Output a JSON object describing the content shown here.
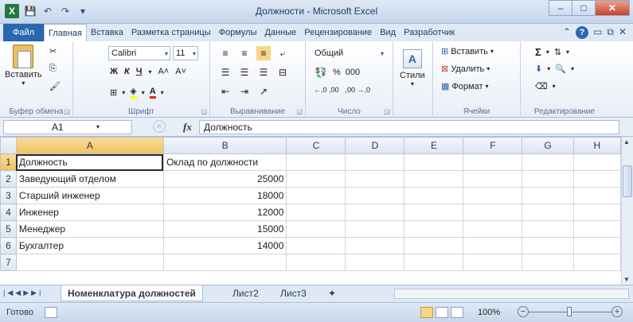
{
  "window": {
    "title": "Должности - Microsoft Excel",
    "minimize": "–",
    "maximize": "□",
    "close": "✕"
  },
  "qat": {
    "app_icon": "X",
    "save_icon": "save-icon",
    "undo_icon": "undo-icon",
    "redo_icon": "redo-icon"
  },
  "ribbon_tabs": [
    "Файл",
    "Главная",
    "Вставка",
    "Разметка страницы",
    "Формулы",
    "Данные",
    "Рецензирование",
    "Вид",
    "Разработчик"
  ],
  "ribbon": {
    "clipboard": {
      "label": "Буфер обмена",
      "paste": "Вставить"
    },
    "font": {
      "label": "Шрифт",
      "name": "Calibri",
      "size": "11",
      "bold": "Ж",
      "italic": "К",
      "underline": "Ч",
      "grow": "A˄",
      "shrink": "A˅"
    },
    "alignment": {
      "label": "Выравнивание"
    },
    "number": {
      "label": "Число",
      "format": "Общий",
      "percent": "%",
      "thousands": "000",
      "inc_decimal": "←,0 ,00",
      "dec_decimal": ",00 →,0"
    },
    "styles": {
      "label": "Стили"
    },
    "cells": {
      "label": "Ячейки",
      "insert": "Вставить",
      "delete": "Удалить",
      "format": "Формат"
    },
    "editing": {
      "label": "Редактирование",
      "sum": "Σ"
    }
  },
  "formula_bar": {
    "name_box": "A1",
    "fx": "fx",
    "formula": "Должность"
  },
  "columns": [
    "A",
    "B",
    "C",
    "D",
    "E",
    "F",
    "G",
    "H"
  ],
  "rows": [
    {
      "n": "1",
      "a": "Должность",
      "b": "Оклад по должности"
    },
    {
      "n": "2",
      "a": "Заведующий отделом",
      "b": "25000"
    },
    {
      "n": "3",
      "a": "Старший инженер",
      "b": "18000"
    },
    {
      "n": "4",
      "a": "Инженер",
      "b": "12000"
    },
    {
      "n": "5",
      "a": "Менеджер",
      "b": "15000"
    },
    {
      "n": "6",
      "a": "Бухгалтер",
      "b": "14000"
    },
    {
      "n": "7",
      "a": "",
      "b": ""
    }
  ],
  "sheets": [
    "Номенклатура должностей",
    "Лист2",
    "Лист3"
  ],
  "status": {
    "ready": "Готово",
    "zoom": "100%",
    "zoom_level": 1.0
  }
}
